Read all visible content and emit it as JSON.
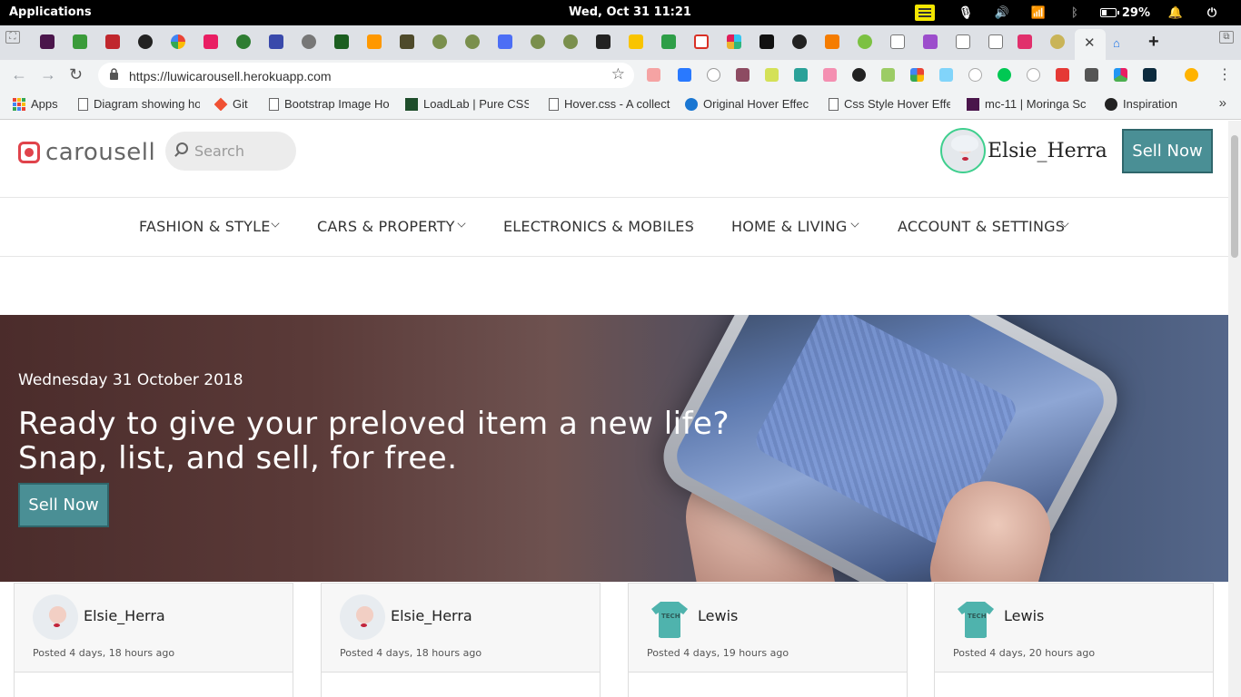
{
  "os": {
    "apps_label": "Applications",
    "clock": "Wed, Oct 31    11:21",
    "battery": "29%",
    "battery_level": 0.29
  },
  "browser": {
    "url": "https://luwicarousell.herokuapp.com",
    "bookmarks": [
      "Apps",
      "Diagram showing ho",
      "Git",
      "Bootstrap Image Ho",
      "LoadLab | Pure CSS",
      "Hover.css - A collect",
      "Original Hover Effec",
      "Css Style Hover Effe",
      "mc-11 | Moringa Sc",
      "Inspiration"
    ],
    "more": "»"
  },
  "site": {
    "logo": "carousell",
    "search_placeholder": "Search",
    "user_name": "Elsie_Herra",
    "sell_label": "Sell Now",
    "categories": [
      "FASHION & STYLE",
      "CARS & PROPERTY",
      "ELECTRONICS & MOBILES",
      "HOME & LIVING",
      "ACCOUNT & SETTINGS"
    ],
    "accent_color": "#4a8f95"
  },
  "hero": {
    "date": "Wednesday 31 October 2018",
    "line1": "Ready to give your preloved item a new life?",
    "line2": "Snap, list, and sell, for free.",
    "button": "Sell Now"
  },
  "listings": [
    {
      "user": "Elsie_Herra",
      "posted": "Posted 4 days, 18 hours ago",
      "avatar": "elsie-avatar"
    },
    {
      "user": "Elsie_Herra",
      "posted": "Posted 4 days, 18 hours ago",
      "avatar": "elsie-avatar"
    },
    {
      "user": "Lewis",
      "posted": "Posted 4 days, 19 hours ago",
      "avatar": "tech-wizard-shirt-avatar"
    },
    {
      "user": "Lewis",
      "posted": "Posted 4 days, 20 hours ago",
      "avatar": "tech-wizard-shirt-avatar"
    }
  ]
}
